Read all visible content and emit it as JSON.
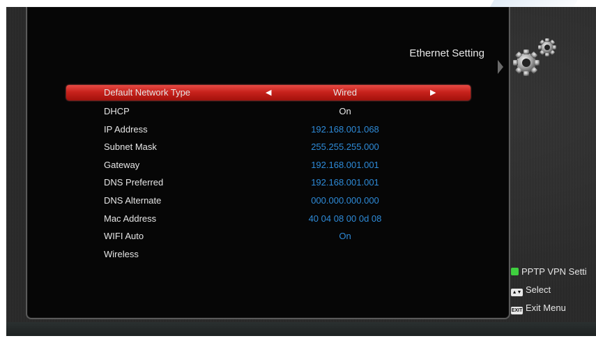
{
  "header": {
    "title": "Ethernet Setting",
    "icon": "gears-icon"
  },
  "menu": {
    "rows": [
      {
        "label": "Default Network Type",
        "value": "Wired",
        "selected": true,
        "value_color": "white"
      },
      {
        "label": "DHCP",
        "value": "On",
        "value_color": "white"
      },
      {
        "label": "IP Address",
        "value": "192.168.001.068",
        "value_color": "blue"
      },
      {
        "label": "Subnet Mask",
        "value": "255.255.255.000",
        "value_color": "blue"
      },
      {
        "label": "Gateway",
        "value": "192.168.001.001",
        "value_color": "blue"
      },
      {
        "label": "DNS Preferred",
        "value": "192.168.001.001",
        "value_color": "blue"
      },
      {
        "label": "DNS Alternate",
        "value": "000.000.000.000",
        "value_color": "blue"
      },
      {
        "label": "Mac Address",
        "value": "40 04 08 00 0d 08",
        "value_color": "blue"
      },
      {
        "label": "WIFI Auto",
        "value": "On",
        "value_color": "blue"
      },
      {
        "label": "Wireless",
        "value": "",
        "value_color": "white"
      }
    ]
  },
  "legend": {
    "green": "PPTP VPN Setti",
    "select_key": "Select",
    "exit_key_label": "EXIT",
    "exit": "Exit Menu"
  },
  "colors": {
    "highlight": "#c8221c",
    "value_blue": "#2e8bd8",
    "green_key": "#3fcf3f",
    "panel_bg": "#060606"
  }
}
